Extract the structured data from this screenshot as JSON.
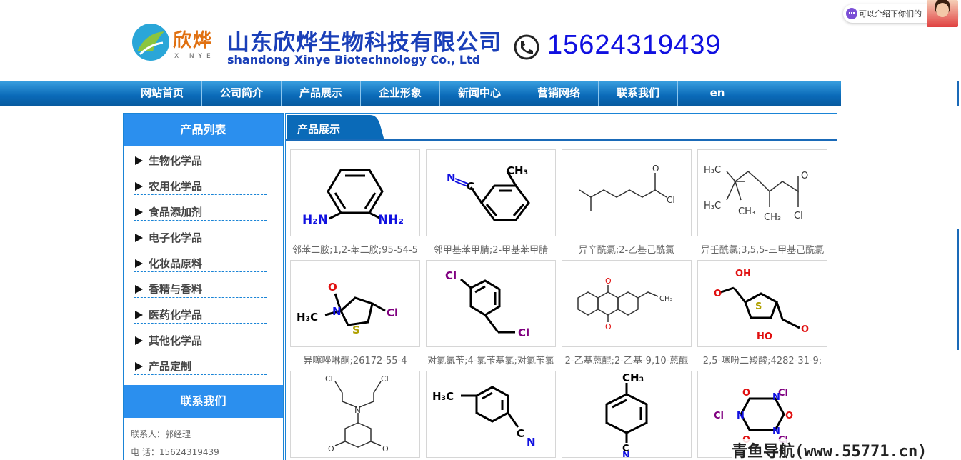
{
  "header": {
    "logo_cn": "欣烨",
    "logo_en": "XINYE",
    "company_cn": "山东欣烨生物科技有限公司",
    "company_en": "shandong Xinye Biotechnology Co., Ltd",
    "phone": "15624319439"
  },
  "chat": {
    "text": "可以介绍下你们的"
  },
  "nav": {
    "items": [
      "网站首页",
      "公司简介",
      "产品展示",
      "企业形象",
      "新闻中心",
      "营销网络",
      "联系我们",
      "en"
    ]
  },
  "sidebar": {
    "title": "产品列表",
    "items": [
      "生物化学品",
      "农用化学品",
      "食品添加剂",
      "电子化学品",
      "化妆品原料",
      "香精与香料",
      "医药化学品",
      "其他化学品",
      "产品定制"
    ],
    "contact_title": "联系我们",
    "contact_person": "联系人：郭经理",
    "contact_phone": "电 话：15624319439"
  },
  "products": {
    "title": "产品展示",
    "items": [
      {
        "caption": "邻苯二胺;1,2-苯二胺;95-54-5",
        "labels": [
          "H₂N",
          "NH₂"
        ]
      },
      {
        "caption": "邻甲基苯甲腈;2-甲基苯甲腈",
        "labels": [
          "N",
          "C",
          "CH₃"
        ]
      },
      {
        "caption": "异辛酰氯;2-乙基己酰氯",
        "labels": [
          "O",
          "Cl"
        ]
      },
      {
        "caption": "异壬酰氯;3,5,5-三甲基己酰氯",
        "labels": [
          "H₃C",
          "H₃C",
          "CH₃",
          "CH₃",
          "O",
          "Cl"
        ]
      },
      {
        "caption": "异噻唑啉酮;26172-55-4",
        "labels": [
          "O",
          "N",
          "H₃C",
          "S",
          "Cl"
        ]
      },
      {
        "caption": "对氯氯苄;4-氯苄基氯;对氯苄氯",
        "labels": [
          "Cl",
          "Cl"
        ]
      },
      {
        "caption": "2-乙基蒽醌;2-乙基-9,10-蒽醌",
        "labels": [
          "O",
          "O",
          "CH₃"
        ]
      },
      {
        "caption": "2,5-噻吩二羧酸;4282-31-9;",
        "labels": [
          "OH",
          "O",
          "S",
          "HO",
          "O"
        ]
      },
      {
        "caption": "",
        "labels": [
          "Cl",
          "Cl",
          "N",
          "O",
          "O"
        ]
      },
      {
        "caption": "",
        "labels": [
          "H₃C",
          "C",
          "N"
        ]
      },
      {
        "caption": "",
        "labels": [
          "CH₃",
          "C",
          "N"
        ]
      },
      {
        "caption": "",
        "labels": [
          "O",
          "Cl",
          "N",
          "Cl",
          "N",
          "O",
          "N",
          "O",
          "Cl"
        ]
      }
    ]
  },
  "watermark": "青鱼导航(www.55771.cn)",
  "colors": {
    "nav_blue": "#0a6ab8",
    "side_blue": "#2b8fee",
    "brand_blue": "#1a3fb8",
    "phone_blue": "#1010e0"
  }
}
